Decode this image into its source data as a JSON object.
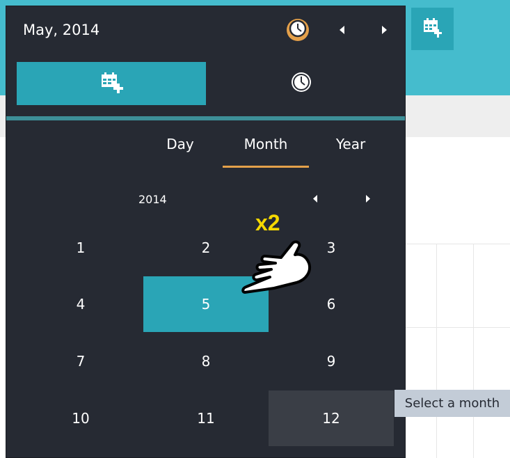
{
  "header": {
    "date_label": "May, 2014",
    "clock_icon": "clock-icon",
    "prev_icon": "triangle-left-icon",
    "next_icon": "triangle-right-icon",
    "add_event_icon": "calendar-plus-icon"
  },
  "mode_tabs": {
    "calendar_icon": "calendar-plus-icon",
    "time_icon": "clock-icon",
    "active": "calendar"
  },
  "view_tabs": [
    {
      "label": "Day"
    },
    {
      "label": "Month"
    },
    {
      "label": "Year"
    }
  ],
  "view_tabs_active": "Month",
  "year_nav": {
    "year": "2014",
    "prev_icon": "triangle-left-icon",
    "next_icon": "triangle-right-icon"
  },
  "months": [
    "1",
    "2",
    "3",
    "4",
    "5",
    "6",
    "7",
    "8",
    "9",
    "10",
    "11",
    "12"
  ],
  "selected_month": "5",
  "hovered_month": "12",
  "tooltip": "Select a month",
  "annotation": {
    "label": "x2",
    "icon": "pointing-hand-icon"
  },
  "colors": {
    "accent": "#2aa5b6",
    "highlight": "#e4a04a",
    "panel": "#262a33",
    "header_bg": "#45bccd",
    "annotation": "#f5d800"
  }
}
